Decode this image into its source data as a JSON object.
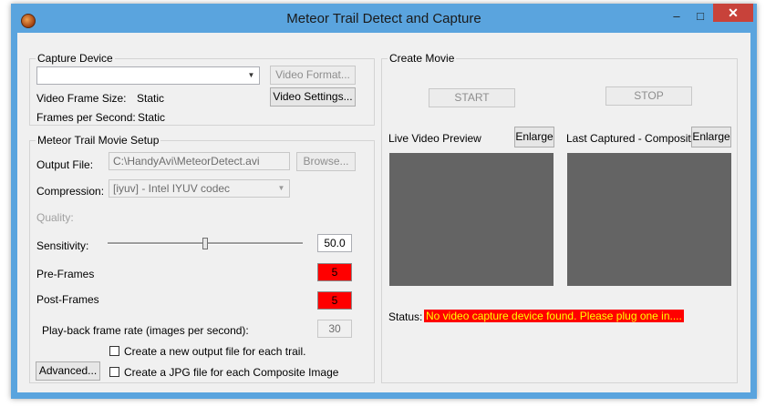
{
  "window": {
    "title": "Meteor Trail Detect and Capture",
    "controls": {
      "minimize": "–",
      "maximize": "□",
      "close": "✕"
    }
  },
  "capture_device": {
    "legend": "Capture Device",
    "device_value": "",
    "video_format_label": "Video Format...",
    "video_settings_label": "Video Settings...",
    "frame_size_label": "Video Frame Size:",
    "frame_size_value": "Static",
    "fps_label": "Frames per Second:",
    "fps_value": "Static"
  },
  "movie_setup": {
    "legend": "Meteor Trail Movie Setup",
    "output_file_label": "Output File:",
    "output_file_value": "C:\\HandyAvi\\MeteorDetect.avi",
    "browse_label": "Browse...",
    "compression_label": "Compression:",
    "compression_value": "[iyuv] - Intel IYUV codec",
    "quality_label": "Quality:",
    "sensitivity_label": "Sensitivity:",
    "sensitivity_value": "50.0",
    "sensitivity_fraction": 0.5,
    "preframes_label": "Pre-Frames",
    "preframes_value": "5",
    "postframes_label": "Post-Frames",
    "postframes_value": "5",
    "playback_label": "Play-back frame rate (images per second):",
    "playback_value": "30",
    "new_file_label": "Create a new output file for each trail.",
    "jpg_label": "Create a JPG file for each Composite Image",
    "advanced_label": "Advanced..."
  },
  "create_movie": {
    "legend": "Create Movie",
    "start_label": "START",
    "stop_label": "STOP",
    "live_preview_label": "Live Video Preview",
    "last_captured_label": "Last Captured - Composite",
    "enlarge_label": "Enlarge",
    "status_label": "Status:",
    "status_value": "No video capture device found.  Please plug one in...."
  },
  "colors": {
    "titlebar": "#5aa4de",
    "client": "#f0f0f0",
    "preview": "#646464",
    "alert_bg": "#ff0000",
    "alert_text": "#ffff00",
    "close_button": "#c8423a"
  },
  "icons": {
    "app": "meteor-app-icon",
    "dropdown": "chevron-down-icon"
  }
}
